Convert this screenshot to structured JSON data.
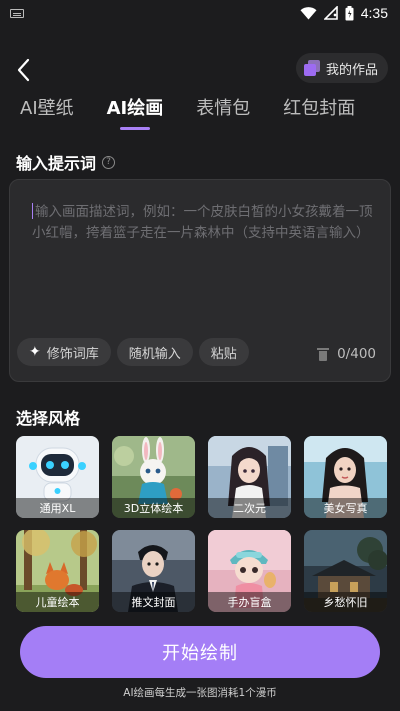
{
  "status_bar": {
    "time": "4:35",
    "icons": [
      "keyboard-icon",
      "wifi-icon",
      "signal-icon",
      "battery-icon"
    ]
  },
  "header": {
    "back_icon": "chevron-left-icon",
    "my_works_label": "我的作品"
  },
  "tabs": [
    {
      "label": "AI壁纸",
      "active": false
    },
    {
      "label": "AI绘画",
      "active": true
    },
    {
      "label": "表情包",
      "active": false
    },
    {
      "label": "红包封面",
      "active": false
    }
  ],
  "prompt": {
    "section_title": "输入提示词",
    "placeholder": "输入画面描述词，例如：一个皮肤白皙的小女孩戴着一顶小红帽，挎着篮子走在一片森林中（支持中英语言输入）",
    "value": "",
    "tools": {
      "modifier_library": "修饰词库",
      "random_input": "随机输入",
      "paste": "粘贴"
    },
    "char_count": "0/400"
  },
  "styles": {
    "section_title": "选择风格",
    "items": [
      {
        "label": "通用XL",
        "icon": "robot-icon"
      },
      {
        "label": "3D立体绘本",
        "icon": "rabbit-icon"
      },
      {
        "label": "二次元",
        "icon": "anime-girl-icon"
      },
      {
        "label": "美女写真",
        "icon": "portrait-icon"
      },
      {
        "label": "儿童绘本",
        "icon": "fox-forest-icon"
      },
      {
        "label": "推文封面",
        "icon": "suited-man-icon"
      },
      {
        "label": "手办盲盒",
        "icon": "figurine-icon"
      },
      {
        "label": "乡愁怀旧",
        "icon": "village-house-icon"
      }
    ]
  },
  "actions": {
    "start_label": "开始绘制",
    "cost_note": "AI绘画每生成一张图消耗1个漫币"
  },
  "colors": {
    "background": "#1c1c1e",
    "accent": "#a47ef6",
    "panel": "#2b2b2d",
    "chip": "#3a3a3c"
  }
}
